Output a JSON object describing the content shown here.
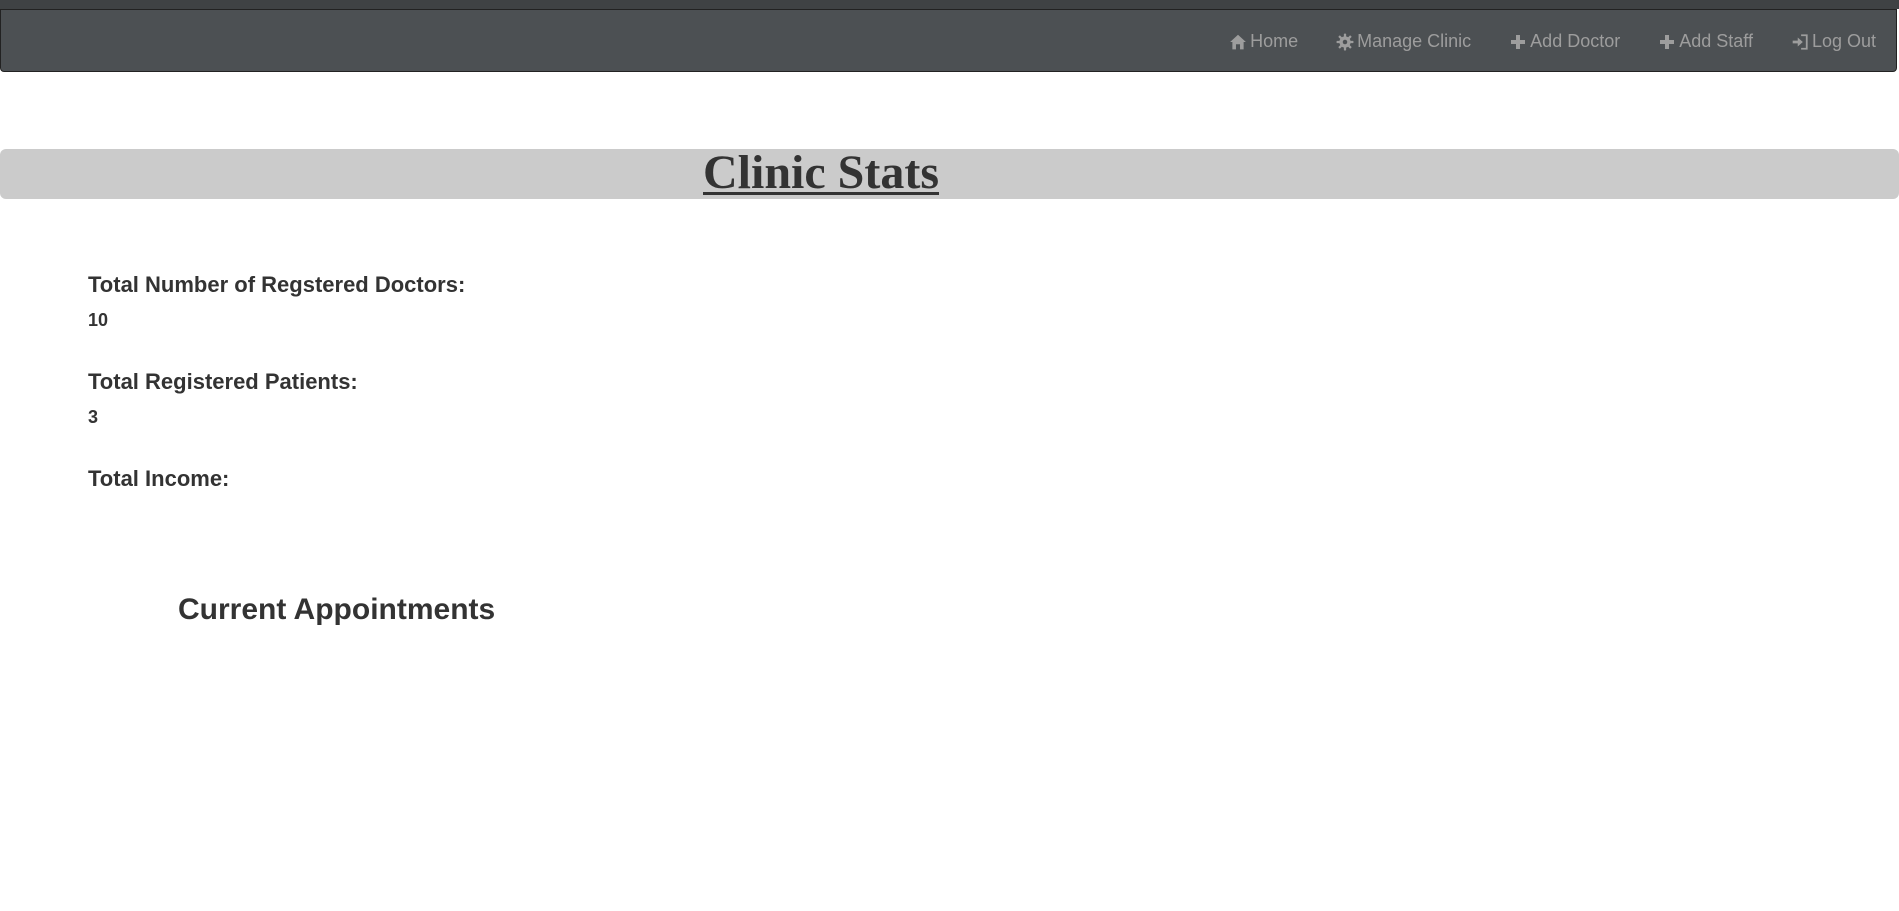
{
  "nav": {
    "items": [
      {
        "label": "Home",
        "icon": "home-icon"
      },
      {
        "label": "Manage Clinic",
        "icon": "gear-icon"
      },
      {
        "label": "Add Doctor",
        "icon": "plus-icon"
      },
      {
        "label": "Add Staff",
        "icon": "plus-icon"
      },
      {
        "label": "Log Out",
        "icon": "log-in-icon"
      }
    ]
  },
  "banner": {
    "title": "Clinic Stats"
  },
  "stats": {
    "doctors_label": "Total Number of Regstered Doctors:",
    "doctors_value": "10",
    "patients_label": "Total Registered Patients:",
    "patients_value": "3",
    "income_label": "Total Income:",
    "income_value": ""
  },
  "appointments": {
    "title": "Current Appointments"
  },
  "colors": {
    "navbar_bg": "#4c5053",
    "nav_text": "#9d9d9d",
    "banner_bg": "#cbcbcb",
    "text": "#333333"
  }
}
